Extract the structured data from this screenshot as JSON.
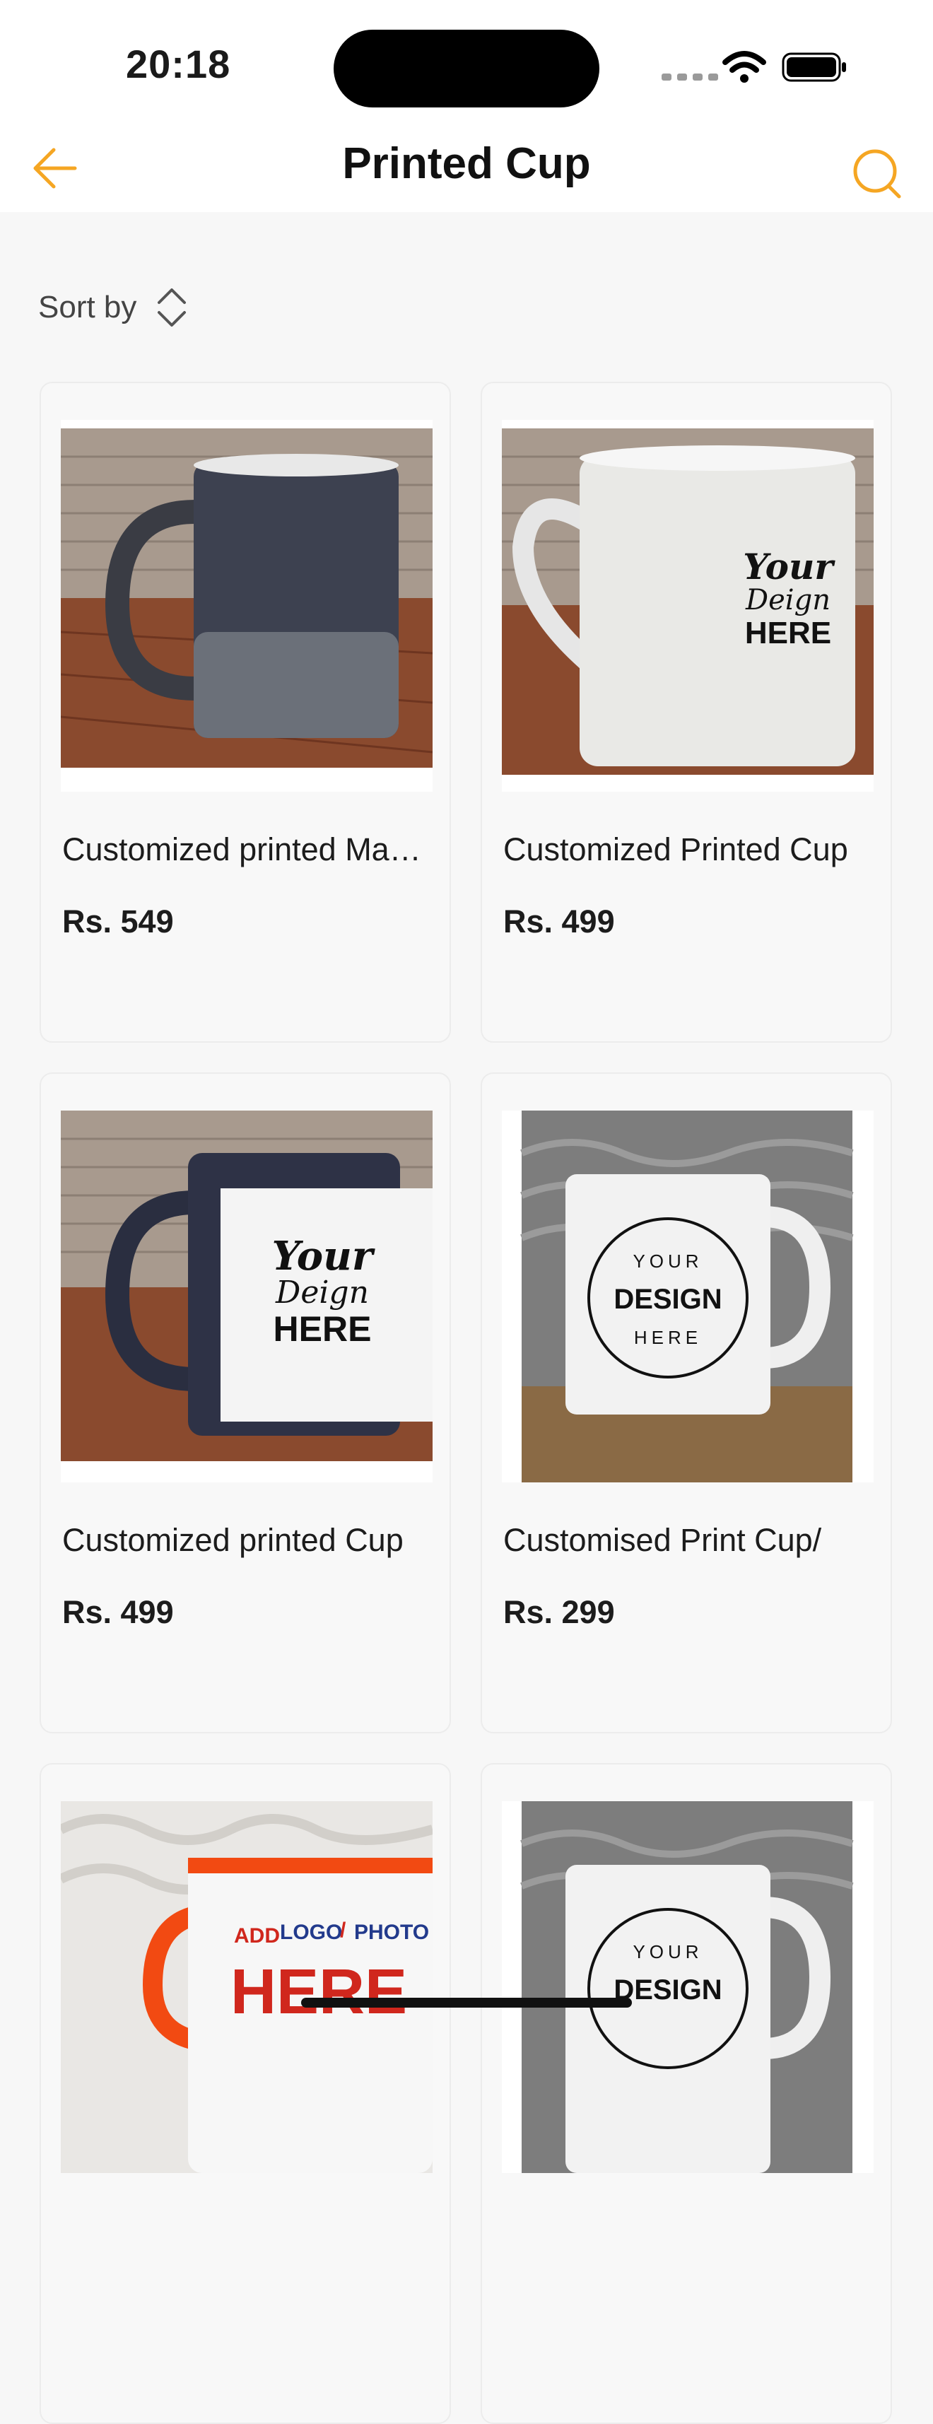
{
  "status_bar": {
    "time": "20:18"
  },
  "header": {
    "title": "Printed Cup"
  },
  "colors": {
    "accent": "#F5A623"
  },
  "sort": {
    "label": "Sort by"
  },
  "products": [
    {
      "name": "Customized printed Magic Cup",
      "price": "Rs. 549",
      "image_text": ""
    },
    {
      "name": "Customized Printed Cup",
      "price": "Rs. 499",
      "image_text": [
        "Your",
        "Deign",
        "HERE"
      ]
    },
    {
      "name": "Customized printed Cup",
      "price": "Rs. 499",
      "image_text": [
        "Your",
        "Deign",
        "HERE"
      ]
    },
    {
      "name": "Customised Print Cup/",
      "price": "Rs. 299",
      "image_text": [
        "YOUR",
        "DESIGN",
        "HERE"
      ]
    },
    {
      "name": "",
      "price": "",
      "image_text": [
        "ADD",
        "LOGO",
        "/",
        "PHOTO",
        "HERE"
      ]
    },
    {
      "name": "",
      "price": "",
      "image_text": [
        "YOUR",
        "DESIGN"
      ]
    }
  ]
}
